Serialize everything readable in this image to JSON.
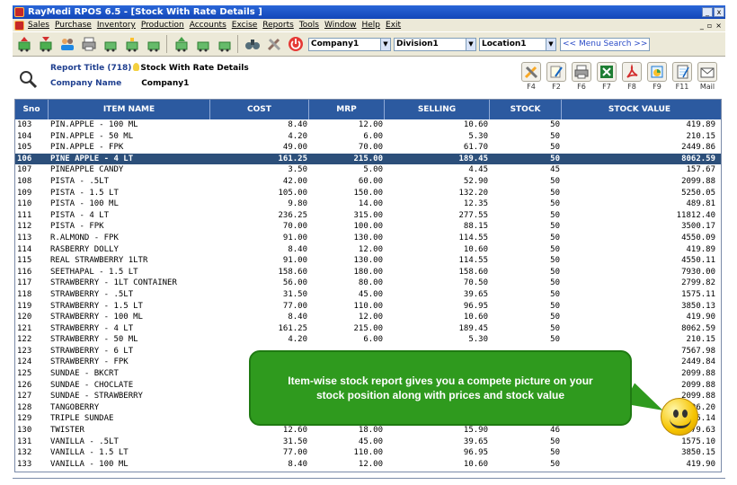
{
  "window": {
    "title": "RayMedi RPOS 6.5 - [Stock With Rate Details ]"
  },
  "menu": [
    "Sales",
    "Purchase",
    "Inventory",
    "Production",
    "Accounts",
    "Excise",
    "Reports",
    "Tools",
    "Window",
    "Help",
    "Exit"
  ],
  "toolbar": {
    "company": "Company1",
    "division": "Division1",
    "location": "Location1",
    "menu_search": "<< Menu Search >>"
  },
  "report": {
    "title_label": "Report Title (718)",
    "title_value": "Stock With Rate Details",
    "company_label": "Company Name",
    "company_value": "Company1"
  },
  "report_icons": [
    {
      "icon": "tools-icon",
      "label": "F4"
    },
    {
      "icon": "pen-icon",
      "label": "F2"
    },
    {
      "icon": "printer-icon",
      "label": "F6"
    },
    {
      "icon": "excel-icon",
      "label": "F7"
    },
    {
      "icon": "pdf-icon",
      "label": "F8"
    },
    {
      "icon": "graph-icon",
      "label": "F9"
    },
    {
      "icon": "notepad-icon",
      "label": "F11"
    },
    {
      "icon": "mail-icon",
      "label": "Mail"
    }
  ],
  "columns": [
    "Sno",
    "ITEM NAME",
    "COST",
    "MRP",
    "SELLING",
    "STOCK",
    "STOCK VALUE"
  ],
  "selected_row": 3,
  "rows": [
    [
      "103",
      "PIN.APPLE - 100 ML",
      "8.40",
      "12.00",
      "10.60",
      "50",
      "419.89"
    ],
    [
      "104",
      "PIN.APPLE - 50 ML",
      "4.20",
      "6.00",
      "5.30",
      "50",
      "210.15"
    ],
    [
      "105",
      "PIN.APPLE - FPK",
      "49.00",
      "70.00",
      "61.70",
      "50",
      "2449.86"
    ],
    [
      "106",
      "PINE APPLE - 4 LT",
      "161.25",
      "215.00",
      "189.45",
      "50",
      "8062.59"
    ],
    [
      "107",
      "PINEAPPLE CANDY",
      "3.50",
      "5.00",
      "4.45",
      "45",
      "157.67"
    ],
    [
      "108",
      "PISTA - .5LT",
      "42.00",
      "60.00",
      "52.90",
      "50",
      "2099.88"
    ],
    [
      "109",
      "PISTA - 1.5 LT",
      "105.00",
      "150.00",
      "132.20",
      "50",
      "5250.05"
    ],
    [
      "110",
      "PISTA - 100 ML",
      "9.80",
      "14.00",
      "12.35",
      "50",
      "489.81"
    ],
    [
      "111",
      "PISTA - 4 LT",
      "236.25",
      "315.00",
      "277.55",
      "50",
      "11812.40"
    ],
    [
      "112",
      "PISTA - FPK",
      "70.00",
      "100.00",
      "88.15",
      "50",
      "3500.17"
    ],
    [
      "113",
      "R.ALMOND - FPK",
      "91.00",
      "130.00",
      "114.55",
      "50",
      "4550.09"
    ],
    [
      "114",
      "RASBERRY DOLLY",
      "8.40",
      "12.00",
      "10.60",
      "50",
      "419.89"
    ],
    [
      "115",
      "REAL STRAWBERRY 1LTR",
      "91.00",
      "130.00",
      "114.55",
      "50",
      "4550.11"
    ],
    [
      "116",
      "SEETHAPAL - 1.5 LT",
      "158.60",
      "180.00",
      "158.60",
      "50",
      "7930.00"
    ],
    [
      "117",
      "STRAWBERRY - 1LT CONTAINER",
      "56.00",
      "80.00",
      "70.50",
      "50",
      "2799.82"
    ],
    [
      "118",
      "STRAWBERRY - .5LT",
      "31.50",
      "45.00",
      "39.65",
      "50",
      "1575.11"
    ],
    [
      "119",
      "STRAWBERRY - 1.5 LT",
      "77.00",
      "110.00",
      "96.95",
      "50",
      "3850.13"
    ],
    [
      "120",
      "STRAWBERRY - 100 ML",
      "8.40",
      "12.00",
      "10.60",
      "50",
      "419.90"
    ],
    [
      "121",
      "STRAWBERRY - 4 LT",
      "161.25",
      "215.00",
      "189.45",
      "50",
      "8062.59"
    ],
    [
      "122",
      "STRAWBERRY - 50 ML",
      "4.20",
      "6.00",
      "5.30",
      "50",
      "210.15"
    ],
    [
      "123",
      "STRAWBERRY - 6 LT",
      "",
      "",
      "",
      "",
      "7567.98"
    ],
    [
      "124",
      "STRAWBERRY - FPK",
      "",
      "",
      "",
      "",
      "2449.84"
    ],
    [
      "125",
      "SUNDAE - BKCRT",
      "",
      "",
      "",
      "",
      "2099.88"
    ],
    [
      "126",
      "SUNDAE - CHOCLATE",
      "",
      "",
      "",
      "",
      "2099.88"
    ],
    [
      "127",
      "SUNDAE - STRAWBERRY",
      "",
      "",
      "",
      "",
      "2099.88"
    ],
    [
      "128",
      "TANGOBERRY",
      "",
      "",
      "",
      "",
      "96.20"
    ],
    [
      "129",
      "TRIPLE SUNDAE",
      "",
      "",
      "",
      "",
      "75.14"
    ],
    [
      "130",
      "TWISTER",
      "12.60",
      "18.00",
      "15.90",
      "46",
      "579.63"
    ],
    [
      "131",
      "VANILLA - .5LT",
      "31.50",
      "45.00",
      "39.65",
      "50",
      "1575.10"
    ],
    [
      "132",
      "VANILLA - 1.5 LT",
      "77.00",
      "110.00",
      "96.95",
      "50",
      "3850.15"
    ],
    [
      "133",
      "VANILLA - 100 ML",
      "8.40",
      "12.00",
      "10.60",
      "50",
      "419.90"
    ]
  ],
  "callout": {
    "text": "Item-wise stock report gives you a compete picture on your stock position along with prices and stock value"
  }
}
